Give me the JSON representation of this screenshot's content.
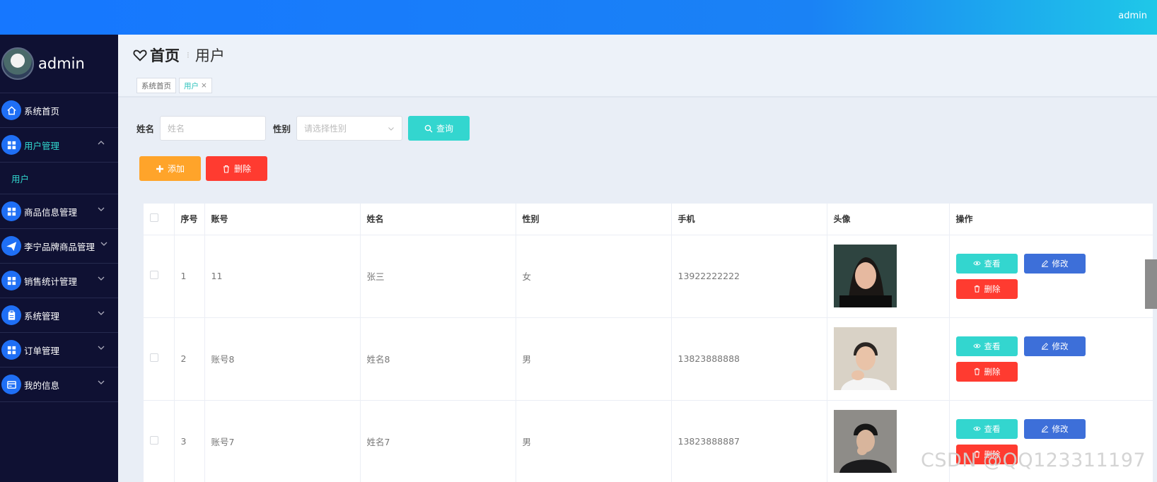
{
  "topbar": {
    "user": "admin"
  },
  "sidebar": {
    "username": "admin",
    "items": [
      {
        "label": "系统首页",
        "icon": "home-icon"
      },
      {
        "label": "用户管理",
        "icon": "grid-icon",
        "expanded": true
      },
      {
        "label": "商品信息管理",
        "icon": "grid-icon"
      },
      {
        "label": "李宁品牌商品管理",
        "icon": "paper-plane-icon"
      },
      {
        "label": "销售统计管理",
        "icon": "grid-icon"
      },
      {
        "label": "系统管理",
        "icon": "clipboard-icon"
      },
      {
        "label": "订单管理",
        "icon": "grid-icon"
      },
      {
        "label": "我的信息",
        "icon": "card-icon"
      }
    ],
    "submenu": {
      "label": "用户"
    }
  },
  "header": {
    "home": "首页",
    "current": "用户",
    "tags": [
      {
        "label": "系统首页"
      },
      {
        "label": "用户"
      }
    ]
  },
  "search": {
    "name_label": "姓名",
    "name_placeholder": "姓名",
    "gender_label": "性别",
    "gender_placeholder": "请选择性别",
    "query_button": "查询"
  },
  "actions": {
    "add_button": "添加",
    "delete_button": "删除"
  },
  "table": {
    "columns": [
      "序号",
      "账号",
      "姓名",
      "性别",
      "手机",
      "头像",
      "操作"
    ],
    "rows": [
      {
        "index": "1",
        "account": "11",
        "name": "张三",
        "gender": "女",
        "phone": "13922222222"
      },
      {
        "index": "2",
        "account": "账号8",
        "name": "姓名8",
        "gender": "男",
        "phone": "13823888888"
      },
      {
        "index": "3",
        "account": "账号7",
        "name": "姓名7",
        "gender": "男",
        "phone": "13823888887"
      }
    ],
    "view_label": "查看",
    "edit_label": "修改",
    "delete_label": "删除"
  },
  "watermark": "CSDN @QQ123311197",
  "colors": {
    "accent": "#33d6cf",
    "primary": "#3d6fd9",
    "danger": "#ff3b30",
    "warning": "#ffa42a",
    "sidebar": "#0f1133"
  }
}
